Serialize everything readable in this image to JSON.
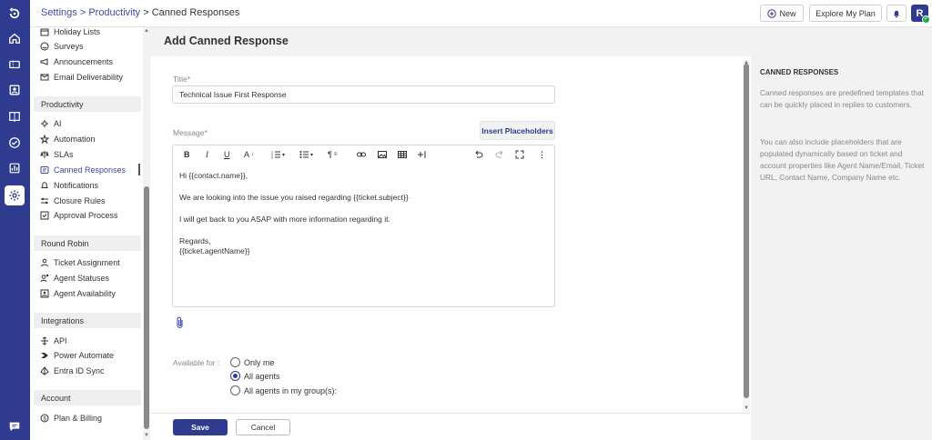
{
  "breadcrumb": {
    "root": "Settings",
    "sep1": ">",
    "section": "Productivity",
    "sep2": ">",
    "current": "Canned Responses"
  },
  "topbar": {
    "new_label": "New",
    "explore_label": "Explore My Plan",
    "avatar_letter": "R"
  },
  "rail": {
    "icons": [
      "logo-icon",
      "home-icon",
      "tickets-icon",
      "contacts-icon",
      "knowledge-base-icon",
      "tasks-icon",
      "reports-icon",
      "settings-icon",
      "chat-icon"
    ]
  },
  "sidebar": {
    "items_top": [
      {
        "label": "Holiday Lists",
        "icon": "calendar-icon"
      },
      {
        "label": "Surveys",
        "icon": "smiley-icon"
      },
      {
        "label": "Announcements",
        "icon": "megaphone-icon"
      },
      {
        "label": "Email Deliverability",
        "icon": "email-icon"
      }
    ],
    "sections": [
      {
        "title": "Productivity",
        "items": [
          {
            "label": "AI",
            "icon": "ai-icon"
          },
          {
            "label": "Automation",
            "icon": "automation-icon"
          },
          {
            "label": "SLAs",
            "icon": "sla-icon"
          },
          {
            "label": "Canned Responses",
            "icon": "canned-responses-icon",
            "active": true
          },
          {
            "label": "Notifications",
            "icon": "bell-icon"
          },
          {
            "label": "Closure Rules",
            "icon": "closure-rules-icon"
          },
          {
            "label": "Approval Process",
            "icon": "approval-icon"
          }
        ]
      },
      {
        "title": "Round Robin",
        "items": [
          {
            "label": "Ticket Assignment",
            "icon": "ticket-assignment-icon"
          },
          {
            "label": "Agent Statuses",
            "icon": "agent-status-icon"
          },
          {
            "label": "Agent Availability",
            "icon": "agent-availability-icon"
          }
        ]
      },
      {
        "title": "Integrations",
        "items": [
          {
            "label": "API",
            "icon": "api-icon"
          },
          {
            "label": "Power Automate",
            "icon": "power-automate-icon"
          },
          {
            "label": "Entra ID Sync",
            "icon": "entra-id-icon"
          }
        ]
      },
      {
        "title": "Account",
        "items": [
          {
            "label": "Plan & Billing",
            "icon": "billing-icon"
          }
        ]
      }
    ]
  },
  "form": {
    "heading": "Add Canned Response",
    "title_label": "Title*",
    "title_value": "Technical Issue First Response",
    "message_label": "Message*",
    "insert_placeholders": "Insert Placeholders",
    "toolbar_icons": [
      "bold-icon",
      "italic-icon",
      "underline-icon",
      "font-size-icon",
      "ordered-list-icon",
      "unordered-list-icon",
      "paragraph-icon",
      "link-icon",
      "image-icon",
      "table-icon",
      "insert-icon",
      "undo-icon",
      "redo-icon",
      "fullscreen-icon",
      "more-icon"
    ],
    "message_lines": [
      "Hi {{contact.name}},",
      "We are looking into the issue you raised regarding {{ticket.subject}}",
      "I will get back to you ASAP with more information regarding it.",
      "Regards,",
      "{{ticket.agentName}}"
    ],
    "available_label": "Available for :",
    "options": [
      {
        "label": "Only me",
        "selected": false
      },
      {
        "label": "All agents",
        "selected": true
      },
      {
        "label": "All agents in my group(s):",
        "selected": false
      }
    ],
    "save_label": "Save",
    "cancel_label": "Cancel"
  },
  "info_panel": {
    "heading": "CANNED RESPONSES",
    "para1": "Canned responses are predefined templates that can be quickly placed in replies to customers.",
    "para2": "You can also include placeholders that are populated dynamically based on ticket and account properties like Agent Name/Email, Ticket URL, Contact Name, Company Name etc."
  },
  "colors": {
    "brand": "#2e3b8f",
    "link": "#3d4ba6",
    "panel": "#f2f2f2",
    "online": "#1fa84a"
  }
}
